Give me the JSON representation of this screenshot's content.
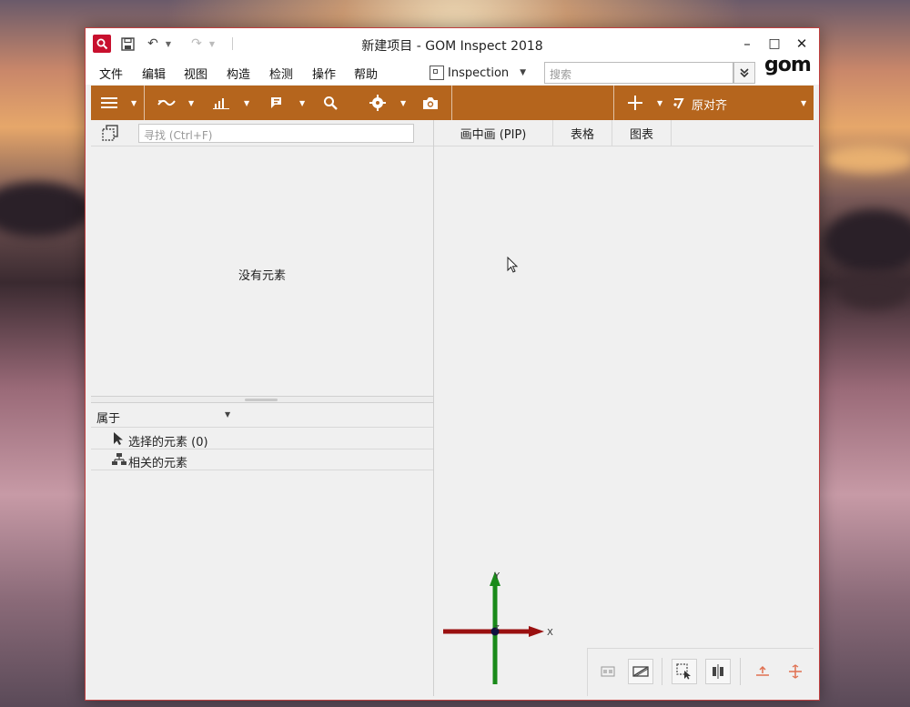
{
  "window": {
    "title": "新建项目 - GOM Inspect 2018",
    "minimize": "–",
    "maximize": "□",
    "close": "✕"
  },
  "quick_access": {
    "undo_icon": "↶",
    "redo_icon": "↷",
    "dropdown": "▼"
  },
  "menu": {
    "items": [
      "文件",
      "编辑",
      "视图",
      "构造",
      "检测",
      "操作",
      "帮助"
    ]
  },
  "workspace": {
    "label": "Inspection",
    "arrow": "▼"
  },
  "search": {
    "placeholder": "搜索",
    "button": "»"
  },
  "logo": {
    "text": "gom"
  },
  "toolbar": {
    "prealign_label": "原对齐",
    "dropdown": "▼",
    "accent_color": "#b5651d"
  },
  "explorer": {
    "find_placeholder": "寻找 (Ctrl+F)",
    "empty_message": "没有元素"
  },
  "properties": {
    "belong_label": "属于",
    "dropdown": "▼",
    "items": [
      {
        "label": "选择的元素 (0)"
      },
      {
        "label": "相关的元素"
      }
    ]
  },
  "view_tabs": [
    "画中画 (PIP)",
    "表格",
    "图表"
  ],
  "axes": {
    "x_label": "X",
    "y_label": "Y",
    "z_label": "Z"
  }
}
